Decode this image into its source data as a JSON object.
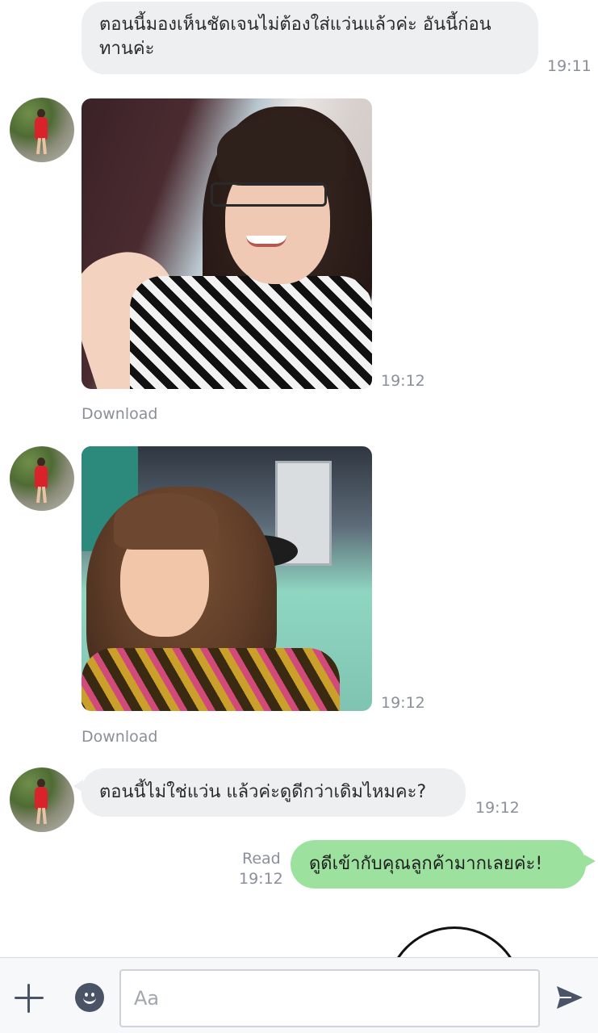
{
  "messages": {
    "msg1": {
      "text": "ตอนนี้มองเห็นชัดเจนไม่ต้องใส่แว่นแล้วค่ะ อันนี้ก่อนทานค่ะ",
      "time": "19:11"
    },
    "photo1": {
      "time": "19:12",
      "download_label": "Download"
    },
    "photo2": {
      "time": "19:12",
      "download_label": "Download"
    },
    "msg2": {
      "text": "ตอนนี้ไม่ใช่แว่น แล้วค่ะดูดีกว่าเดิมไหมคะ?",
      "time": "19:12"
    },
    "msg3": {
      "text": "ดูดีเข้ากับคุณลูกค้ามากเลยค่ะ!",
      "read_label": "Read",
      "time": "19:12"
    }
  },
  "input": {
    "placeholder": "Aa"
  },
  "icons": {
    "add": "plus-icon",
    "emoji": "emoji-icon",
    "send": "send-icon"
  },
  "colors": {
    "incoming_bubble": "#eeeff1",
    "outgoing_bubble": "#9ce29e",
    "timestamp": "#8a8f99",
    "icon": "#4a5466"
  }
}
